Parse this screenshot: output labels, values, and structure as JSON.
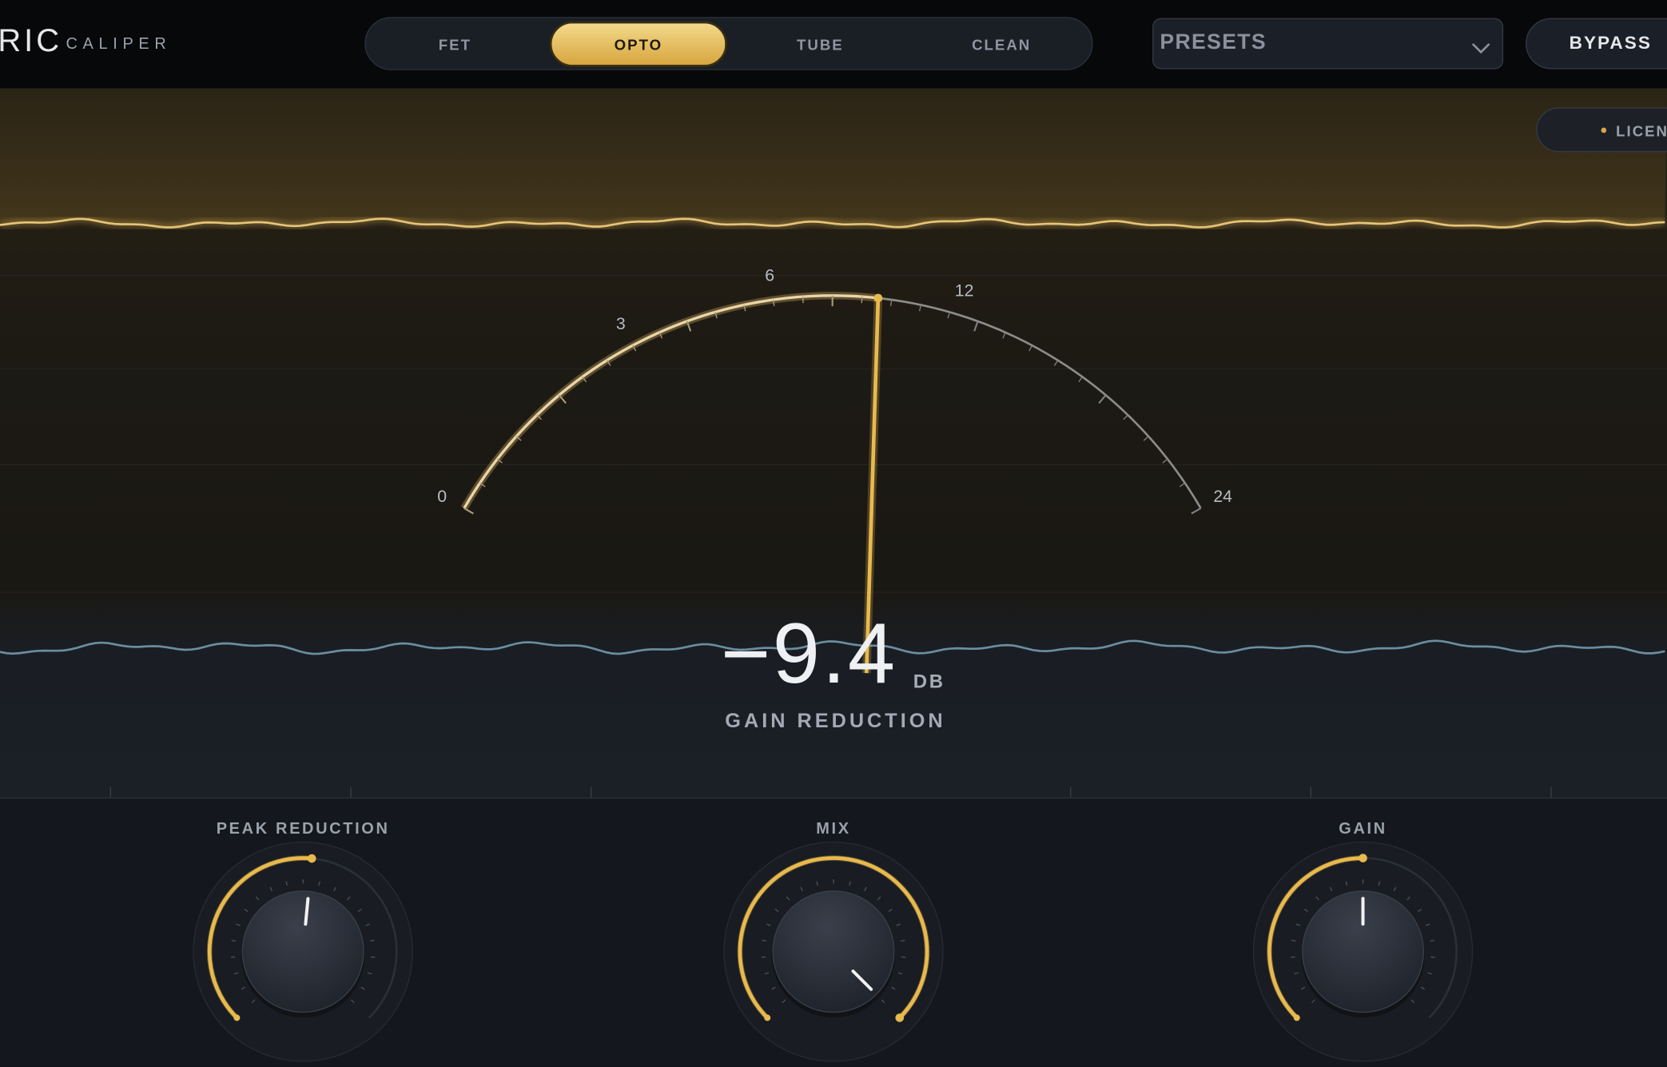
{
  "header": {
    "brand_mark": "RIC",
    "brand_name": "CALIPER",
    "modes": [
      {
        "label": "FET",
        "active": false
      },
      {
        "label": "OPTO",
        "active": true
      },
      {
        "label": "TUBE",
        "active": false
      },
      {
        "label": "CLEAN",
        "active": false
      }
    ],
    "presets_label": "PRESETS",
    "bypass_label": "BYPASS"
  },
  "license": {
    "label": "LICENSE"
  },
  "meter": {
    "scale_labels": [
      "0",
      "3",
      "6",
      "12",
      "24"
    ],
    "scale_min": 0,
    "scale_max": 24,
    "readout_value": "−9.4",
    "readout_unit": "DB",
    "readout_label": "GAIN REDUCTION",
    "needle_value_db": 9.4
  },
  "colors": {
    "accent": "#e8b94d",
    "input_wave": "#d9b062",
    "output_wave": "#6a8ea2"
  },
  "controls": {
    "knobs": [
      {
        "label": "PEAK REDUCTION",
        "value_fraction": 0.52
      },
      {
        "label": "MIX",
        "value_fraction": 1.0
      },
      {
        "label": "GAIN",
        "value_fraction": 0.5
      }
    ]
  }
}
